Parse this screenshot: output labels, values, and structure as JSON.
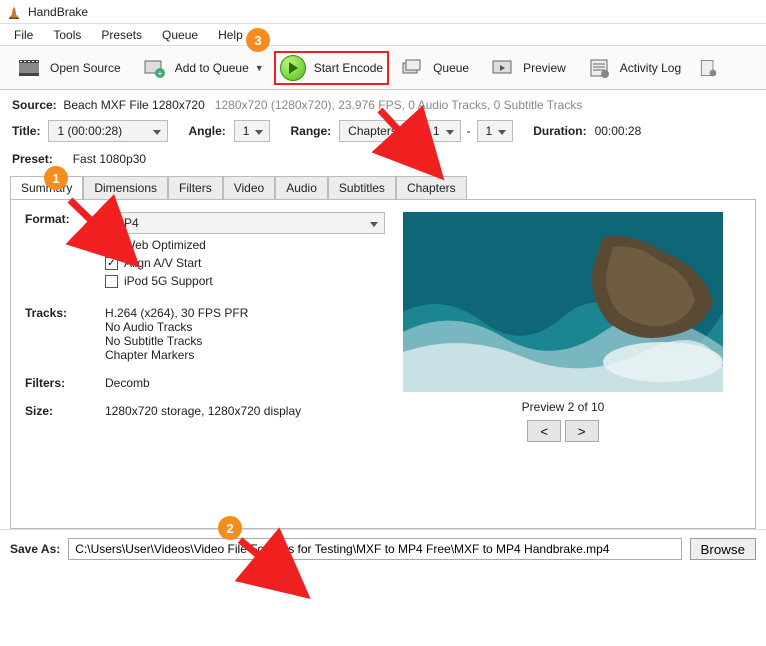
{
  "app_name": "HandBrake",
  "menu": {
    "file": "File",
    "tools": "Tools",
    "presets": "Presets",
    "queue": "Queue",
    "help": "Help"
  },
  "toolbar": {
    "open_source": "Open Source",
    "add_queue": "Add to Queue",
    "start_encode": "Start Encode",
    "queue": "Queue",
    "preview": "Preview",
    "activity": "Activity Log"
  },
  "source": {
    "label": "Source:",
    "name": "Beach MXF File 1280x720",
    "details": "1280x720 (1280x720), 23.976 FPS, 0 Audio Tracks, 0 Subtitle Tracks"
  },
  "params": {
    "title_label": "Title:",
    "title_value": "1 (00:00:28)",
    "angle_label": "Angle:",
    "angle_value": "1",
    "range_label": "Range:",
    "range_type": "Chapters",
    "range_from": "1",
    "range_dash": "-",
    "range_to": "1",
    "duration_label": "Duration:",
    "duration_value": "00:00:28"
  },
  "preset": {
    "label": "Preset:",
    "value": "Fast 1080p30"
  },
  "tabs": [
    "Summary",
    "Dimensions",
    "Filters",
    "Video",
    "Audio",
    "Subtitles",
    "Chapters"
  ],
  "summary": {
    "format_label": "Format:",
    "format_value": "MP4",
    "opt_web": "Web Optimized",
    "opt_align": "Align A/V Start",
    "opt_ipod": "iPod 5G Support",
    "tracks_label": "Tracks:",
    "tracks_lines": [
      "H.264 (x264), 30 FPS PFR",
      "No Audio Tracks",
      "No Subtitle Tracks",
      "Chapter Markers"
    ],
    "filters_label": "Filters:",
    "filters_value": "Decomb",
    "size_label": "Size:",
    "size_value": "1280x720 storage, 1280x720 display"
  },
  "preview": {
    "caption": "Preview 2 of 10",
    "prev": "<",
    "next": ">"
  },
  "save": {
    "label": "Save As:",
    "path": "C:\\Users\\User\\Videos\\Video File Formats for Testing\\MXF to MP4 Free\\MXF to MP4 Handbrake.mp4",
    "browse": "Browse"
  },
  "annotations": {
    "n1": "1",
    "n2": "2",
    "n3": "3"
  }
}
